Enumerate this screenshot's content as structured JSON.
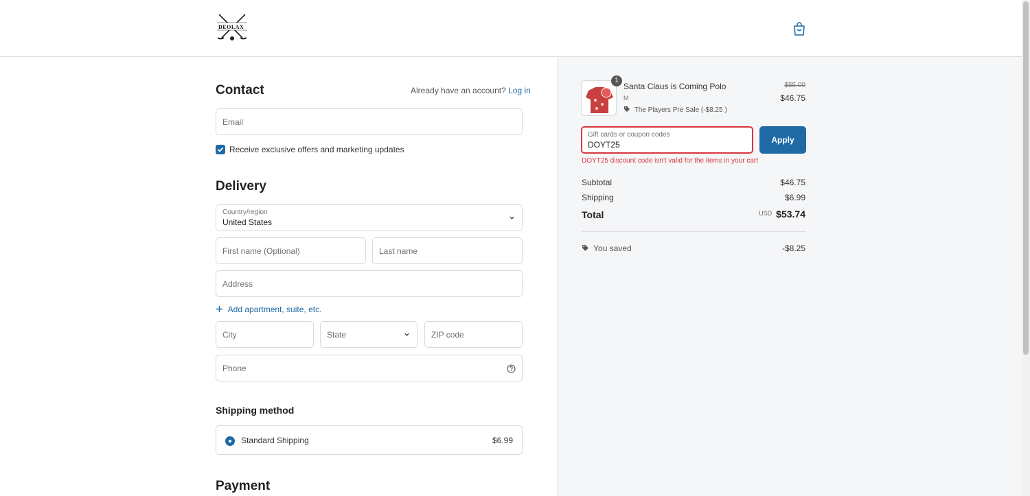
{
  "header": {
    "logo_text": "DEOLAX",
    "cart_icon": "shopping-bag-icon"
  },
  "contact": {
    "title": "Contact",
    "account_prompt": "Already have an account?",
    "login_link": "Log in",
    "email_placeholder": "Email",
    "marketing_label": "Receive exclusive offers and marketing updates",
    "marketing_checked": true
  },
  "delivery": {
    "title": "Delivery",
    "country_label": "Country/region",
    "country_value": "United States",
    "first_name_placeholder": "First name (Optional)",
    "last_name_placeholder": "Last name",
    "address_placeholder": "Address",
    "add_apartment_link": "Add apartment, suite, etc.",
    "city_placeholder": "City",
    "state_placeholder": "State",
    "zip_placeholder": "ZIP code",
    "phone_placeholder": "Phone"
  },
  "shipping_method": {
    "title": "Shipping method",
    "option_label": "Standard Shipping",
    "option_price": "$6.99"
  },
  "payment": {
    "title": "Payment"
  },
  "summary": {
    "product": {
      "quantity": "1",
      "name": "Santa Claus is Coming Polo",
      "variant": "M",
      "discount_label": "The Players Pre Sale (-$8.25 )",
      "original_price": "$55.00",
      "price": "$46.75"
    },
    "coupon_label": "Gift cards or coupon codes",
    "coupon_value": "DOYT25",
    "apply_label": "Apply",
    "coupon_error": "DOYT25 discount code isn't valid for the items in your cart",
    "subtotal_label": "Subtotal",
    "subtotal_value": "$46.75",
    "shipping_label": "Shipping",
    "shipping_value": "$6.99",
    "total_label": "Total",
    "currency": "USD",
    "total_value": "$53.74",
    "saved_label": "You saved",
    "saved_value": "-$8.25"
  },
  "colors": {
    "accent": "#1f6aa5",
    "error": "#d9363e",
    "summary_bg": "#f5f6f8"
  }
}
